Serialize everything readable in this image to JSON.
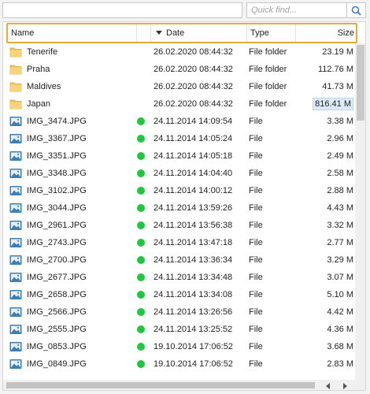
{
  "search": {
    "placeholder": "Quick find...",
    "path_value": ""
  },
  "columns": {
    "name": "Name",
    "date": "Date",
    "type": "Type",
    "size": "Size"
  },
  "colors": {
    "header_highlight": "#e8a93a",
    "status_ok": "#1ec83c",
    "folder": "#f2c25a",
    "image_icon": "#3c7fb5"
  },
  "rows": [
    {
      "kind": "folder",
      "name": "Tenerife",
      "status": false,
      "date": "26.02.2020 08:44:32",
      "type": "File folder",
      "size": "23.19 M",
      "icon": "folder-icon"
    },
    {
      "kind": "folder",
      "name": "Praha",
      "status": false,
      "date": "26.02.2020 08:44:32",
      "type": "File folder",
      "size": "112.76 M",
      "icon": "folder-icon"
    },
    {
      "kind": "folder",
      "name": "Maldives",
      "status": false,
      "date": "26.02.2020 08:44:32",
      "type": "File folder",
      "size": "41.73 M",
      "icon": "folder-icon"
    },
    {
      "kind": "folder",
      "name": "Japan",
      "status": false,
      "date": "26.02.2020 08:44:32",
      "type": "File folder",
      "size": "816.41 M",
      "icon": "folder-icon",
      "highlight": true
    },
    {
      "kind": "image",
      "name": "IMG_3474.JPG",
      "status": true,
      "date": "24.11.2014 14:09:54",
      "type": "File",
      "size": "3.38 M",
      "icon": "image-file-icon"
    },
    {
      "kind": "image",
      "name": "IMG_3367.JPG",
      "status": true,
      "date": "24.11.2014 14:05:24",
      "type": "File",
      "size": "2.96 M",
      "icon": "image-file-icon"
    },
    {
      "kind": "image",
      "name": "IMG_3351.JPG",
      "status": true,
      "date": "24.11.2014 14:05:18",
      "type": "File",
      "size": "2.49 M",
      "icon": "image-file-icon"
    },
    {
      "kind": "image",
      "name": "IMG_3348.JPG",
      "status": true,
      "date": "24.11.2014 14:04:40",
      "type": "File",
      "size": "2.58 M",
      "icon": "image-file-icon"
    },
    {
      "kind": "image",
      "name": "IMG_3102.JPG",
      "status": true,
      "date": "24.11.2014 14:00:12",
      "type": "File",
      "size": "2.88 M",
      "icon": "image-file-icon"
    },
    {
      "kind": "image",
      "name": "IMG_3044.JPG",
      "status": true,
      "date": "24.11.2014 13:59:26",
      "type": "File",
      "size": "4.43 M",
      "icon": "image-file-icon"
    },
    {
      "kind": "image",
      "name": "IMG_2961.JPG",
      "status": true,
      "date": "24.11.2014 13:56:38",
      "type": "File",
      "size": "3.32 M",
      "icon": "image-file-icon"
    },
    {
      "kind": "image",
      "name": "IMG_2743.JPG",
      "status": true,
      "date": "24.11.2014 13:47:18",
      "type": "File",
      "size": "2.77 M",
      "icon": "image-file-icon"
    },
    {
      "kind": "image",
      "name": "IMG_2700.JPG",
      "status": true,
      "date": "24.11.2014 13:36:34",
      "type": "File",
      "size": "3.29 M",
      "icon": "image-file-icon"
    },
    {
      "kind": "image",
      "name": "IMG_2677.JPG",
      "status": true,
      "date": "24.11.2014 13:34:48",
      "type": "File",
      "size": "3.07 M",
      "icon": "image-file-icon"
    },
    {
      "kind": "image",
      "name": "IMG_2658.JPG",
      "status": true,
      "date": "24.11.2014 13:34:08",
      "type": "File",
      "size": "5.10 M",
      "icon": "image-file-icon"
    },
    {
      "kind": "image",
      "name": "IMG_2566.JPG",
      "status": true,
      "date": "24.11.2014 13:26:56",
      "type": "File",
      "size": "4.42 M",
      "icon": "image-file-icon"
    },
    {
      "kind": "image",
      "name": "IMG_2555.JPG",
      "status": true,
      "date": "24.11.2014 13:25:52",
      "type": "File",
      "size": "4.36 M",
      "icon": "image-file-icon"
    },
    {
      "kind": "image",
      "name": "IMG_0853.JPG",
      "status": true,
      "date": "19.10.2014 17:06:52",
      "type": "File",
      "size": "3.68 M",
      "icon": "image-file-icon"
    },
    {
      "kind": "image",
      "name": "IMG_0849.JPG",
      "status": true,
      "date": "19.10.2014 17:06:52",
      "type": "File",
      "size": "2.83 M",
      "icon": "image-file-icon"
    }
  ]
}
